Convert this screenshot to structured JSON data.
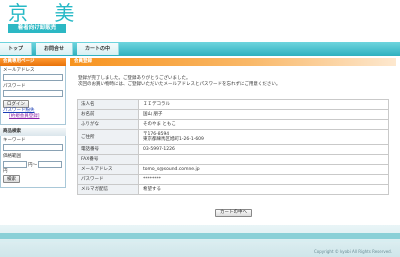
{
  "header": {
    "logo_title": "京 美",
    "logo_subtitle": "着者向け卸販売"
  },
  "nav": {
    "tabs": [
      "トップ",
      "お問合せ",
      "カートの中"
    ]
  },
  "sidebar": {
    "member_title": "会員専用ページ",
    "email_label": "メールアドレス",
    "password_label": "パスワード",
    "login_button": "ログイン",
    "forgot_link": "パスワード紛失",
    "register_link": "[約規会員登録]",
    "search_title": "商品検索",
    "keyword_label": "キーワード",
    "price_label": "価格範囲",
    "price_sep": "円〜",
    "price_unit": "円",
    "search_button": "検索"
  },
  "main": {
    "title": "会員登録",
    "message_line1": "登録が完了しました。ご登録ありがとうございました。",
    "message_line2": "次回のお買い物時には、ご登録いただいたメールアドレスとパスワードを忘れずにご用意ください。",
    "rows": [
      {
        "label": "法人名",
        "value": "ＩＩデコラル"
      },
      {
        "label": "お名前",
        "value": "国山 朋子"
      },
      {
        "label": "ふりがな",
        "value": "そのやま ともこ"
      },
      {
        "label": "ご住所",
        "value": "〒176-8594",
        "value2": "東京都練馬区旭町1-26-1-609"
      },
      {
        "label": "電話番号",
        "value": "03-5997-1226"
      },
      {
        "label": "FAX番号",
        "value": ""
      },
      {
        "label": "メールアドレス",
        "value": "tomo_s@sound.comne.jp"
      },
      {
        "label": "パスワード",
        "value": "********"
      },
      {
        "label": "メルマガ配信",
        "value": "希望する"
      }
    ],
    "cart_button": "カートの中へ"
  },
  "footer": {
    "copyright": "Copyright © kyobi All Rights Reserved."
  }
}
